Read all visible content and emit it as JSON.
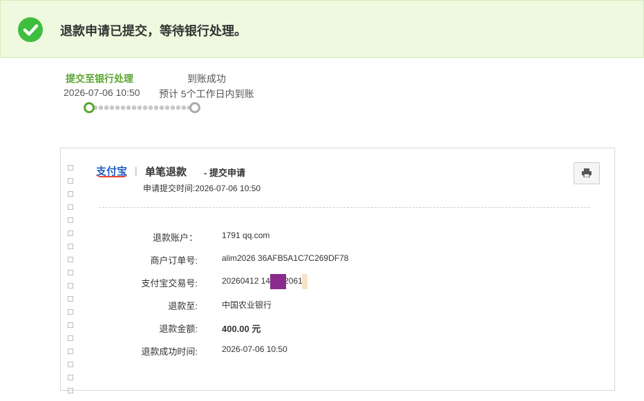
{
  "banner": {
    "message": "退款申请已提交，等待银行处理。"
  },
  "steps": [
    {
      "title": "提交至银行处理",
      "detail": "2026-07-06 10:50",
      "state": "done"
    },
    {
      "title": "到账成功",
      "detail": "预计 5个工作日内到账",
      "state": "pending"
    }
  ],
  "card": {
    "logo_text": "支付宝",
    "separator": "|",
    "title": "单笔退款",
    "subtitle": "- 提交申请",
    "submit_time_label": "申请提交时间:",
    "submit_time": "2026-07-06 10:50",
    "print_icon": "printer-icon",
    "rows": [
      {
        "label": "退款账户：",
        "value": "1791          qq.com"
      },
      {
        "label": "商户订单号:",
        "value": "alim2026                          36AFB5A1C7C269DF78"
      },
      {
        "label": "支付宝交易号:",
        "value": "20260412              1444920618"
      },
      {
        "label": "退款至:",
        "value": "中国农业银行"
      },
      {
        "label": "退款金额:",
        "value": "400.00 元"
      },
      {
        "label": "退款成功时间:",
        "value": "2026-07-06 10:50"
      }
    ]
  },
  "colors": {
    "accent_green": "#5aa532",
    "banner_bg": "#eef9df",
    "check_green": "#3fbd3f"
  }
}
